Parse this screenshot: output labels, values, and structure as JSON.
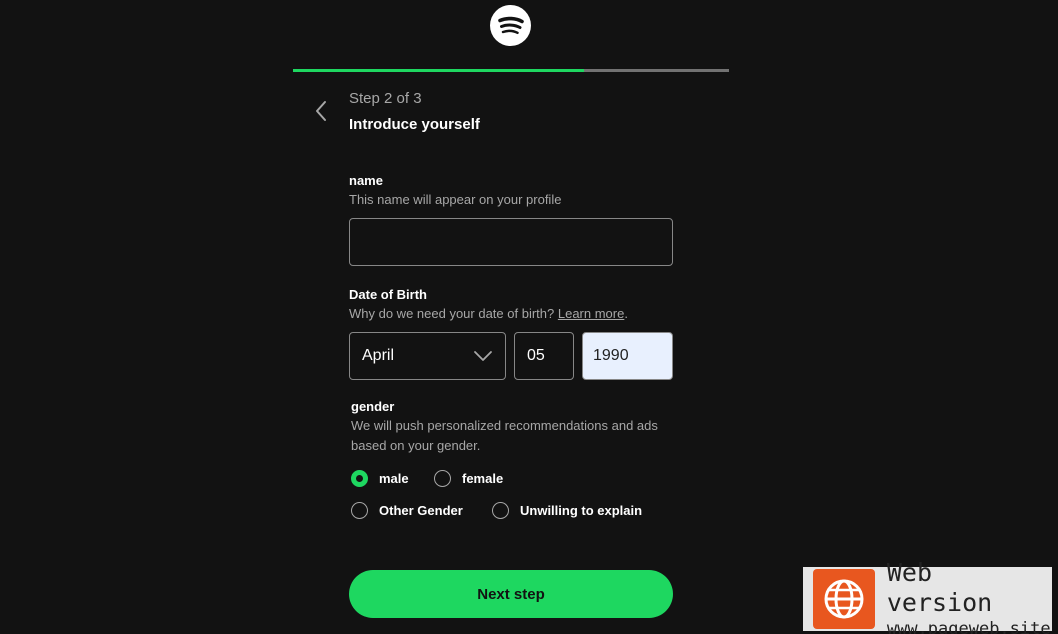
{
  "logo": {
    "icon": "spotify-logo-icon"
  },
  "progress": {
    "value": 0.667,
    "fill_color": "#1ed760",
    "track_color": "#727272"
  },
  "header": {
    "back_icon": "chevron-left-icon",
    "step": "Step 2 of 3",
    "title": "Introduce yourself"
  },
  "name_field": {
    "label": "name",
    "help": "This name will appear on your profile",
    "value": "",
    "placeholder": ""
  },
  "dob_field": {
    "label": "Date of Birth",
    "help_prefix": "Why do we need your date of birth?",
    "help_link": "Learn more",
    "help_suffix": ".",
    "month": "April",
    "day": "05",
    "year": "1990"
  },
  "gender_field": {
    "label": "gender",
    "help": "We will push personalized recommendations and ads based on your gender.",
    "options": [
      "male",
      "female",
      "Other Gender",
      "Unwilling to explain"
    ],
    "selected": "male"
  },
  "next_button": {
    "label": "Next step"
  },
  "watermark": {
    "title": "Web version",
    "url": "www.pageweb.site",
    "icon": "globe-icon"
  },
  "colors": {
    "accent": "#1ed760",
    "background": "#121212",
    "muted": "#a7a7a7"
  }
}
